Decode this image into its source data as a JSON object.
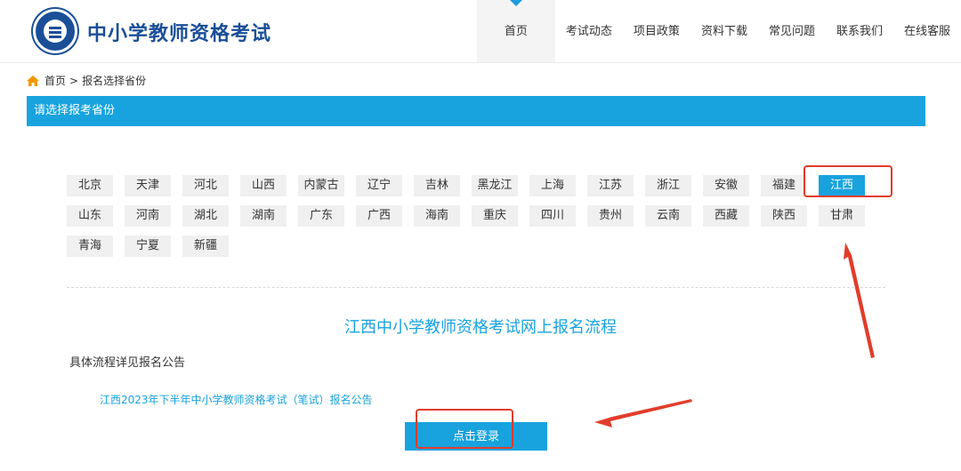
{
  "header": {
    "site_title": "中小学教师资格考试",
    "nav": [
      "首页",
      "考试动态",
      "项目政策",
      "资料下载",
      "常见问题",
      "联系我们",
      "在线客服"
    ]
  },
  "breadcrumb": {
    "home": "首页",
    "separator": ">",
    "current": "报名选择省份"
  },
  "section": {
    "title": "请选择报考省份"
  },
  "provinces": {
    "row1": [
      "北京",
      "天津",
      "河北",
      "山西",
      "内蒙古",
      "辽宁",
      "吉林",
      "黑龙江",
      "上海",
      "江苏",
      "浙江",
      "安徽",
      "福建",
      "江西"
    ],
    "row2": [
      "山东",
      "河南",
      "湖北",
      "湖南",
      "广东",
      "广西",
      "海南",
      "重庆",
      "四川",
      "贵州",
      "云南",
      "西藏",
      "陕西",
      "甘肃"
    ],
    "row3": [
      "青海",
      "宁夏",
      "新疆"
    ],
    "selected": "江西"
  },
  "flow": {
    "title": "江西中小学教师资格考试网上报名流程",
    "note": "具体流程详见报名公告",
    "notice_link": "江西2023年下半年中小学教师资格考试（笔试）报名公告",
    "login_button": "点击登录"
  },
  "colors": {
    "accent": "#18a3df",
    "brand": "#1a4f98",
    "annotation": "#e23c2a"
  }
}
